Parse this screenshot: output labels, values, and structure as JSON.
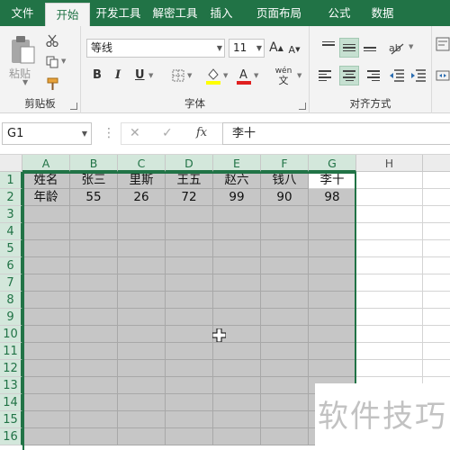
{
  "tabs": [
    {
      "label": "文件"
    },
    {
      "label": "开始"
    },
    {
      "label": "开发工具"
    },
    {
      "label": "解密工具"
    },
    {
      "label": "插入"
    },
    {
      "label": "页面布局"
    },
    {
      "label": "公式"
    },
    {
      "label": "数据"
    }
  ],
  "active_tab": "开始",
  "ribbon": {
    "clipboard": {
      "paste_label": "粘贴",
      "group_label": "剪贴板"
    },
    "font": {
      "font_name": "等线",
      "font_size": "11",
      "bold": "B",
      "italic": "I",
      "underline": "U",
      "phonetic_top": "wén",
      "phonetic_bottom": "文",
      "group_label": "字体"
    },
    "alignment": {
      "group_label": "对齐方式"
    }
  },
  "formula_bar": {
    "name_box": "G1",
    "cancel": "✕",
    "enter": "✓",
    "fx": "fx",
    "content": "李十"
  },
  "grid": {
    "columns": [
      "A",
      "B",
      "C",
      "D",
      "E",
      "F",
      "G",
      "H"
    ],
    "rows": [
      "1",
      "2",
      "3",
      "4",
      "5",
      "6",
      "7",
      "8",
      "9",
      "10",
      "11",
      "12",
      "13",
      "14",
      "15",
      "16"
    ],
    "data": [
      [
        "姓名",
        "张三",
        "里斯",
        "王五",
        "赵六",
        "钱八",
        "李十"
      ],
      [
        "年龄",
        "55",
        "26",
        "72",
        "99",
        "90",
        "98"
      ]
    ],
    "selection": "A1:G16",
    "active_cell": "G1"
  },
  "watermark": "软件技巧",
  "colors": {
    "accent": "#217346",
    "selection_fill": "#c6c6c6",
    "header_bg": "#ececec",
    "selected_header_bg": "#d3e7db"
  }
}
